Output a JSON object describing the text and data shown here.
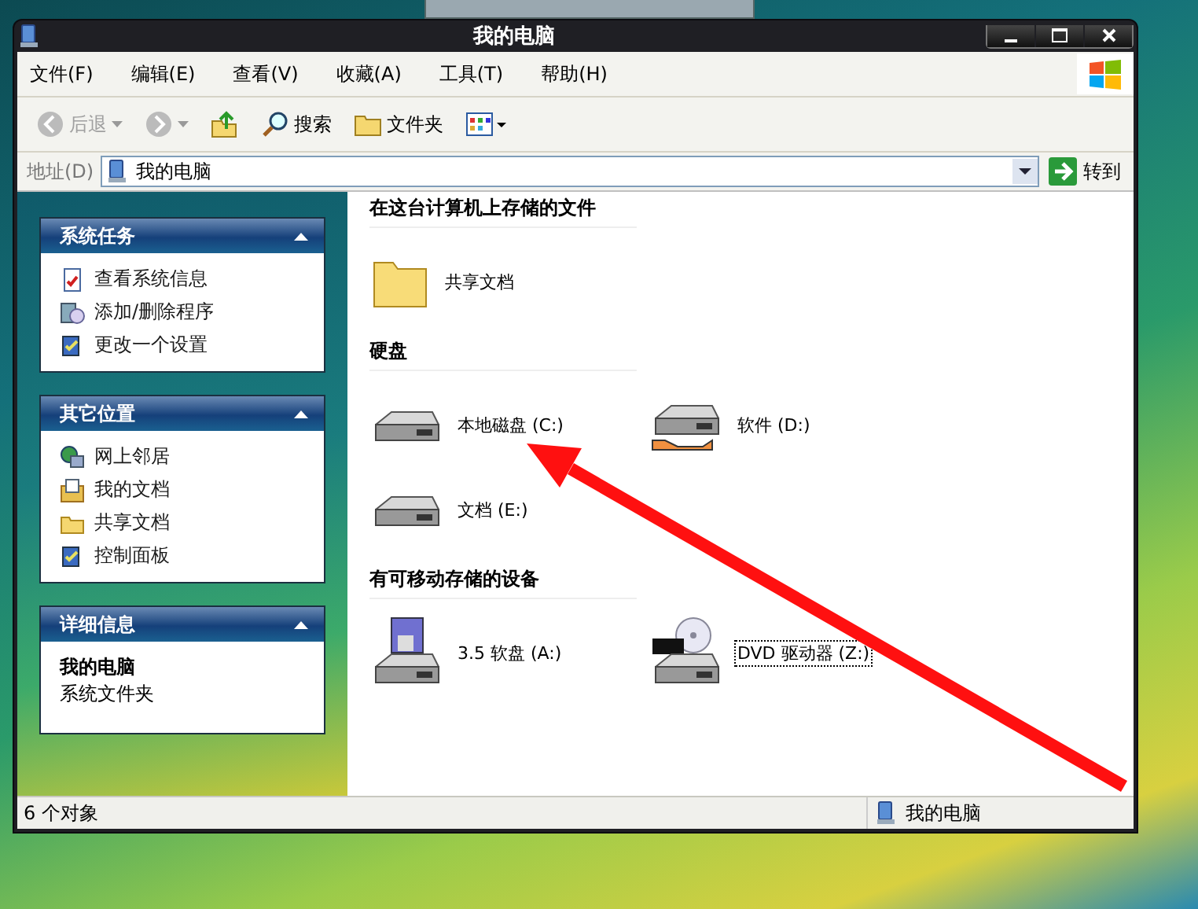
{
  "window": {
    "title": "我的电脑"
  },
  "menu": [
    {
      "label": "文件(F)"
    },
    {
      "label": "编辑(E)"
    },
    {
      "label": "查看(V)"
    },
    {
      "label": "收藏(A)"
    },
    {
      "label": "工具(T)"
    },
    {
      "label": "帮助(H)"
    }
  ],
  "toolbar": {
    "back": {
      "label": "后退",
      "disabled": true
    },
    "forward": {
      "disabled": true
    },
    "search": "搜索",
    "folders": "文件夹"
  },
  "address": {
    "label": "地址(D)",
    "value": "我的电脑",
    "go": "转到"
  },
  "sidebar": [
    {
      "title": "系统任务",
      "expanded": true,
      "kind": "tasks",
      "items": [
        {
          "label": "查看系统信息"
        },
        {
          "label": "添加/删除程序"
        },
        {
          "label": "更改一个设置"
        }
      ]
    },
    {
      "title": "其它位置",
      "expanded": true,
      "kind": "tasks",
      "items": [
        {
          "label": "网上邻居"
        },
        {
          "label": "我的文档"
        },
        {
          "label": "共享文档"
        },
        {
          "label": "控制面板"
        }
      ]
    },
    {
      "title": "详细信息",
      "expanded": true,
      "kind": "details",
      "name": "我的电脑",
      "subtitle": "系统文件夹"
    }
  ],
  "groups": [
    {
      "title": "在这台计算机上存储的文件",
      "items": [
        {
          "label": "共享文档",
          "kind": "folder",
          "selected": false
        }
      ]
    },
    {
      "title": "硬盘",
      "items": [
        {
          "label": "本地磁盘 (C:)",
          "kind": "disk",
          "selected": false
        },
        {
          "label": "软件 (D:)",
          "kind": "shared-disk",
          "selected": false
        },
        {
          "label": "文档 (E:)",
          "kind": "disk",
          "selected": false
        }
      ]
    },
    {
      "title": "有可移动存储的设备",
      "items": [
        {
          "label": "3.5 软盘 (A:)",
          "kind": "floppy",
          "selected": false
        },
        {
          "label": "DVD 驱动器 (Z:)",
          "kind": "dvd",
          "selected": true
        }
      ]
    }
  ],
  "status_bar": {
    "count": "6 个对象",
    "location": "我的电脑"
  }
}
